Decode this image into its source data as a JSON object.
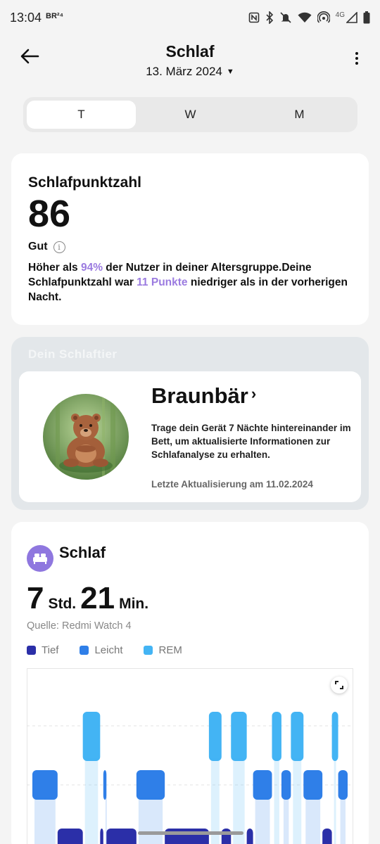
{
  "status_bar": {
    "time": "13:04",
    "badge": "BR²⁴",
    "network": "4G"
  },
  "header": {
    "title": "Schlaf",
    "date": "13. März 2024"
  },
  "tabs": [
    {
      "label": "T",
      "active": true
    },
    {
      "label": "W",
      "active": false
    },
    {
      "label": "M",
      "active": false
    }
  ],
  "score": {
    "title": "Schlafpunktzahl",
    "value": "86",
    "rating": "Gut",
    "desc_1": "Höher als ",
    "percent": "94%",
    "desc_2": " der Nutzer in deiner Altersgruppe.Deine Schlafpunktzahl war ",
    "points": "11 Punkte",
    "desc_3": " niedriger als in der vorherigen Nacht."
  },
  "animal": {
    "heading": "Dein Schlaftier",
    "name": "Braunbär",
    "text": "Trage dein Gerät 7 Nächte hintereinander im Bett, um aktualisierte Informationen zur Schlafanalyse zu erhalten.",
    "updated": "Letzte Aktualisierung am 11.02.2024"
  },
  "sleep": {
    "title": "Schlaf",
    "hours": "7",
    "hours_unit": "Std.",
    "minutes": "21",
    "minutes_unit": "Min.",
    "source": "Quelle: Redmi Watch 4",
    "legend": [
      {
        "label": "Tief",
        "color": "#2b2fa8"
      },
      {
        "label": "Leicht",
        "color": "#2f7fe8"
      },
      {
        "label": "REM",
        "color": "#43b4f4"
      }
    ]
  },
  "chart_data": {
    "type": "area",
    "series_order": [
      "REM",
      "Leicht",
      "Tief"
    ],
    "stages": [
      {
        "stage": "Leicht",
        "start": 0.0,
        "end": 0.08
      },
      {
        "stage": "Tief",
        "start": 0.08,
        "end": 0.16
      },
      {
        "stage": "REM",
        "start": 0.16,
        "end": 0.215
      },
      {
        "stage": "Tief",
        "start": 0.215,
        "end": 0.225
      },
      {
        "stage": "Leicht",
        "start": 0.225,
        "end": 0.235
      },
      {
        "stage": "Tief",
        "start": 0.235,
        "end": 0.33
      },
      {
        "stage": "Leicht",
        "start": 0.33,
        "end": 0.42
      },
      {
        "stage": "Tief",
        "start": 0.42,
        "end": 0.56
      },
      {
        "stage": "REM",
        "start": 0.56,
        "end": 0.6
      },
      {
        "stage": "Tief",
        "start": 0.6,
        "end": 0.63
      },
      {
        "stage": "REM",
        "start": 0.63,
        "end": 0.68
      },
      {
        "stage": "Tief",
        "start": 0.68,
        "end": 0.7
      },
      {
        "stage": "Leicht",
        "start": 0.7,
        "end": 0.76
      },
      {
        "stage": "REM",
        "start": 0.76,
        "end": 0.79
      },
      {
        "stage": "Leicht",
        "start": 0.79,
        "end": 0.82
      },
      {
        "stage": "REM",
        "start": 0.82,
        "end": 0.86
      },
      {
        "stage": "Leicht",
        "start": 0.86,
        "end": 0.92
      },
      {
        "stage": "Tief",
        "start": 0.92,
        "end": 0.95
      },
      {
        "stage": "REM",
        "start": 0.95,
        "end": 0.97
      },
      {
        "stage": "Leicht",
        "start": 0.97,
        "end": 1.0
      }
    ],
    "grid": true
  }
}
